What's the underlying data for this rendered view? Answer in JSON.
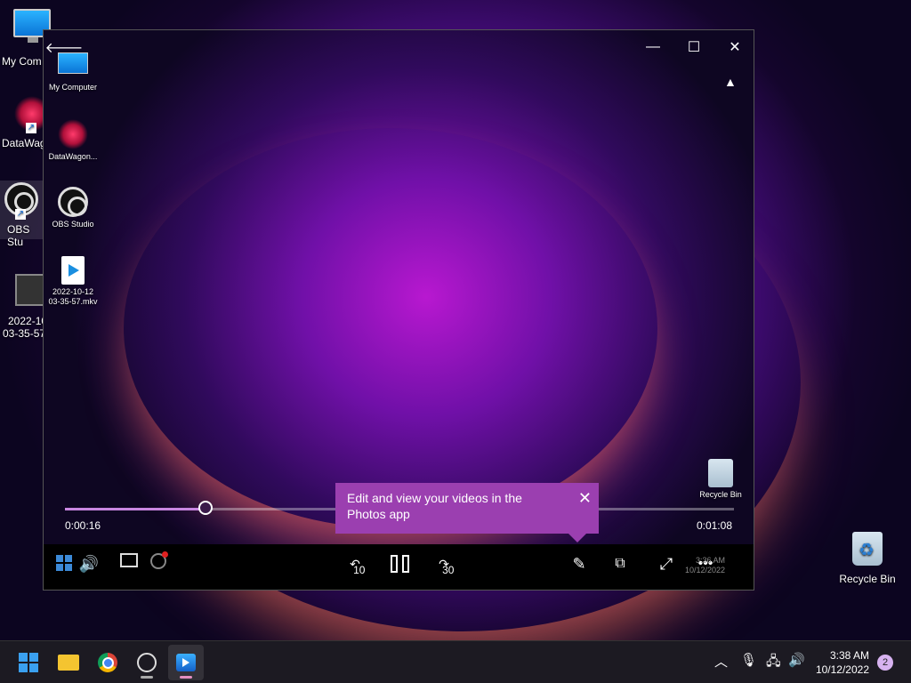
{
  "desktop": {
    "icons": [
      {
        "label": "My Computer",
        "display": "My Com"
      },
      {
        "label": "DataWagon",
        "display": "DataWag"
      },
      {
        "label": "OBS Studio",
        "display": "OBS Stu"
      },
      {
        "label": "2022-10-12 03-35-57.mkv",
        "display_line1": "2022-10",
        "display_line2": "03-35-57"
      }
    ],
    "recycle_bin": "Recycle Bin"
  },
  "player": {
    "back_icon": "arrow-left-icon",
    "window_controls": [
      "minimize-icon",
      "maximize-icon",
      "close-icon"
    ],
    "video_icons": [
      {
        "label": "My Computer"
      },
      {
        "label": "DataWagon..."
      },
      {
        "label": "OBS Studio"
      },
      {
        "line1": "2022-10-12",
        "line2": "03-35-57.mkv"
      }
    ],
    "video_recycle_bin": "Recycle Bin",
    "current_time": "0:00:16",
    "duration": "0:01:08",
    "progress_fraction": 0.21,
    "skip_back": "10",
    "skip_forward": "30",
    "tooltip": {
      "text": "Edit and view your videos in the Photos app"
    },
    "video_clock": {
      "time": "3:36 AM",
      "date": "10/12/2022"
    }
  },
  "taskbar": {
    "apps": [
      "start-icon",
      "file-explorer-icon",
      "chrome-icon",
      "obs-icon",
      "media-player-icon"
    ],
    "tray": [
      "chevron-up-icon",
      "microphone-icon",
      "network-icon",
      "volume-icon"
    ],
    "time": "3:38 AM",
    "date": "10/12/2022",
    "notifications": "2"
  },
  "colors": {
    "accent": "#9b3fb0",
    "progress": "#c886e0"
  }
}
